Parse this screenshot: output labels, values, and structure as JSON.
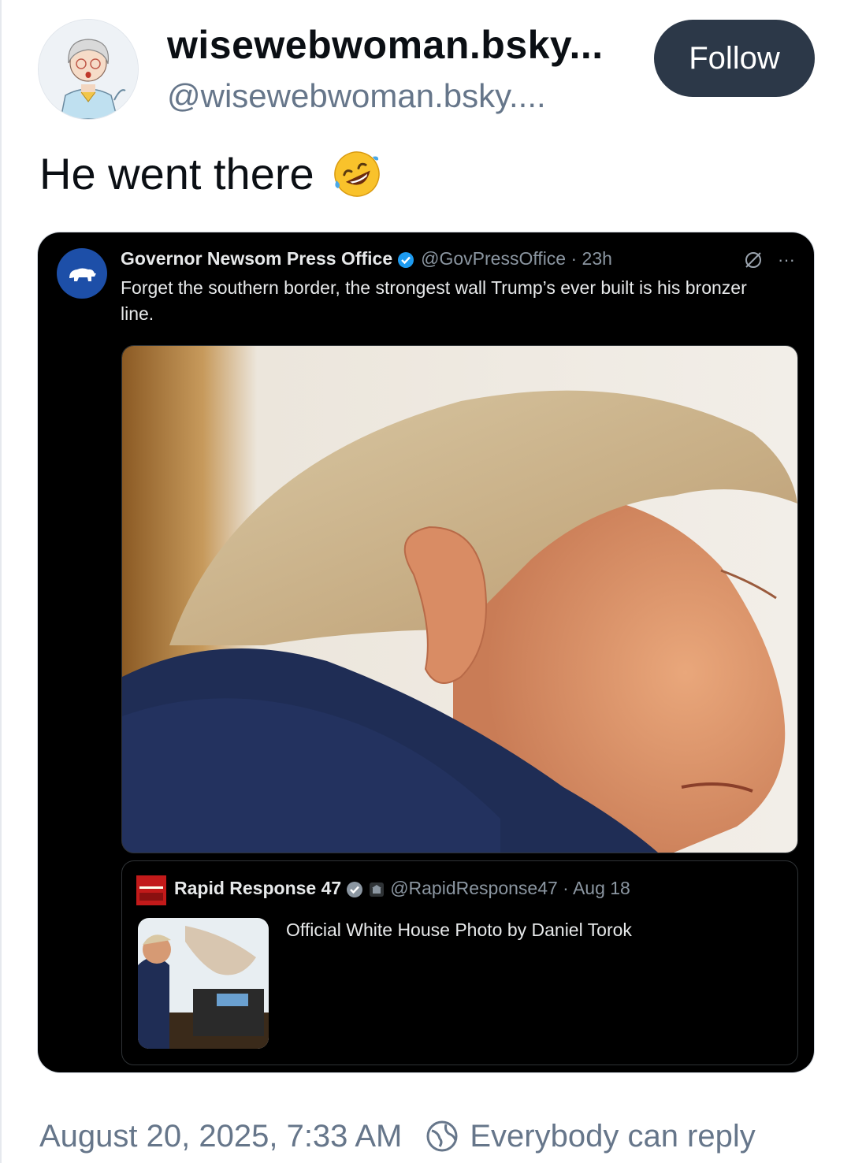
{
  "author": {
    "display_name": "wisewebwoman.bsky...",
    "handle": "@wisewebwoman.bsky....",
    "follow_label": "Follow"
  },
  "post": {
    "text": "He went there",
    "emoji": "rolling-on-floor-laughing-emoji"
  },
  "embedded_tweet": {
    "author_name": "Governor Newsom Press Office",
    "handle_time": "@GovPressOffice · 23h",
    "text": "Forget the southern border, the strongest wall Trump’s ever built is his bronzer line.",
    "more_label": "···",
    "quoted": {
      "author_name": "Rapid Response 47",
      "handle_time": "@RapidResponse47 · Aug 18",
      "text": "Official White House Photo by Daniel Torok"
    }
  },
  "footer": {
    "timestamp": "August 20, 2025, 7:33 AM",
    "reply_setting": "Everybody can reply"
  },
  "colors": {
    "follow_bg": "#2c3848",
    "muted": "#66768a",
    "embed_bg": "#000000",
    "verified": "#1d9bf0"
  }
}
